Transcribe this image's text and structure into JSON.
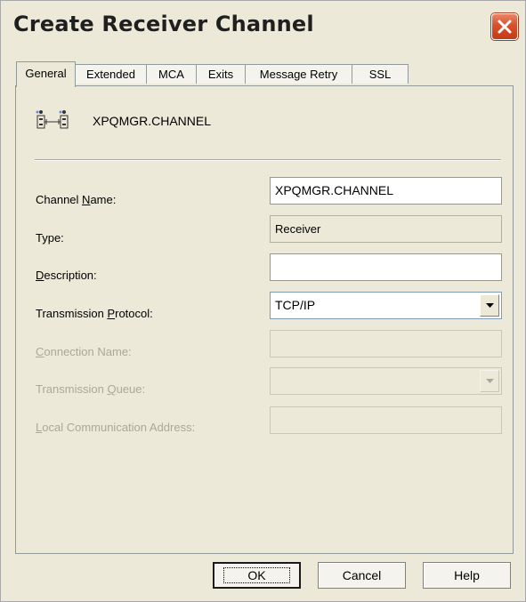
{
  "window": {
    "title": "Create Receiver Channel"
  },
  "tabs": [
    {
      "label": "General"
    },
    {
      "label": "Extended"
    },
    {
      "label": "MCA"
    },
    {
      "label": "Exits"
    },
    {
      "label": "Message Retry"
    },
    {
      "label": "SSL"
    }
  ],
  "header": {
    "channel_display_name": "XPQMGR.CHANNEL",
    "icon": "channel-icon"
  },
  "form": {
    "channel_name": {
      "label_pre": "Channel ",
      "label_acc": "N",
      "label_post": "ame:",
      "value": "XPQMGR.CHANNEL"
    },
    "type": {
      "label": "Type:",
      "value": "Receiver"
    },
    "description": {
      "label_pre": "",
      "label_acc": "D",
      "label_post": "escription:",
      "value": ""
    },
    "transmission_protocol": {
      "label_pre": "Transmission ",
      "label_acc": "P",
      "label_post": "rotocol:",
      "value": "TCP/IP"
    },
    "connection_name": {
      "label_pre": "",
      "label_acc": "C",
      "label_post": "onnection Name:",
      "value": ""
    },
    "transmission_queue": {
      "label_pre": "Transmission ",
      "label_acc": "Q",
      "label_post": "ueue:",
      "value": ""
    },
    "local_communication_address": {
      "label_pre": "",
      "label_acc": "L",
      "label_post": "ocal Communication Address:",
      "value": ""
    }
  },
  "buttons": {
    "ok": "OK",
    "cancel": "Cancel",
    "help": "Help"
  },
  "colors": {
    "close_button": "#d8502c",
    "dialog_bg": "#ece9d8",
    "field_border": "#7f9db9",
    "disabled_text": "#aca899"
  }
}
